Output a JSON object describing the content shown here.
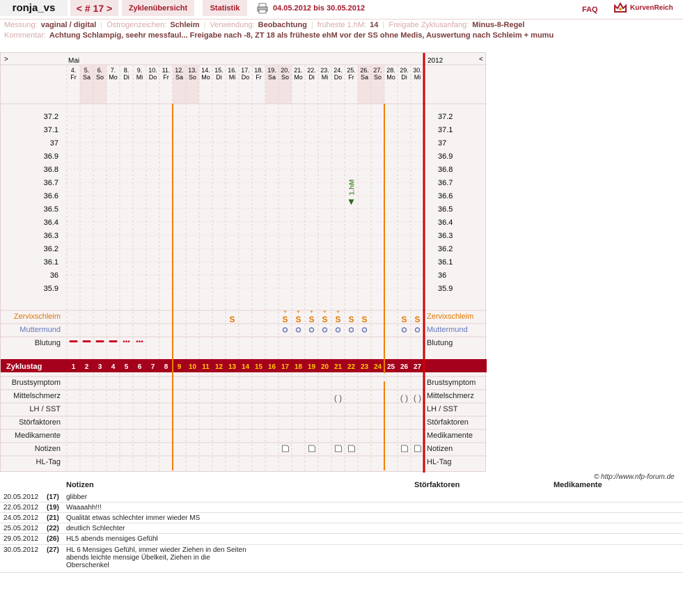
{
  "header": {
    "username": "ronja_vs",
    "cycle_prev": "<",
    "cycle_label": "# 17",
    "cycle_next": ">",
    "tab_overview": "Zyklenübersicht",
    "tab_stats": "Statistik",
    "print_icon": "printer-icon",
    "date_range": "04.05.2012 bis 30.05.2012",
    "faq": "FAQ",
    "logo_icon": "crown-icon",
    "logo_text": "KurvenReich"
  },
  "info": {
    "row1": [
      {
        "label": "Messung:",
        "value": "vaginal / digital"
      },
      {
        "label": "Östrogenzeichen:",
        "value": "Schleim"
      },
      {
        "label": "Verwendung:",
        "value": "Beobachtung"
      },
      {
        "label": "früheste 1.hM:",
        "value": "14"
      },
      {
        "label": "Freigabe Zyklusanfang:",
        "value": "Minus-8-Regel"
      }
    ],
    "comment_label": "Kommentar:",
    "comment": "Achtung Schlampig, seehr messfaul... Freigabe nach -8, ZT 18 als früheste ehM vor der SS ohne Medis, Auswertung nach Schleim + mumu"
  },
  "chart": {
    "nav_left": ">",
    "nav_right": "<",
    "month": "Mai",
    "year": "2012",
    "days": [
      {
        "d": "4.",
        "w": "Fr"
      },
      {
        "d": "5.",
        "w": "Sa"
      },
      {
        "d": "6.",
        "w": "So"
      },
      {
        "d": "7.",
        "w": "Mo"
      },
      {
        "d": "8.",
        "w": "Di"
      },
      {
        "d": "9.",
        "w": "Mi"
      },
      {
        "d": "10.",
        "w": "Do"
      },
      {
        "d": "11.",
        "w": "Fr"
      },
      {
        "d": "12.",
        "w": "Sa"
      },
      {
        "d": "13.",
        "w": "So"
      },
      {
        "d": "14.",
        "w": "Mo"
      },
      {
        "d": "15.",
        "w": "Di"
      },
      {
        "d": "16.",
        "w": "Mi"
      },
      {
        "d": "17.",
        "w": "Do"
      },
      {
        "d": "18.",
        "w": "Fr"
      },
      {
        "d": "19.",
        "w": "Sa"
      },
      {
        "d": "20.",
        "w": "So"
      },
      {
        "d": "21.",
        "w": "Mo"
      },
      {
        "d": "22.",
        "w": "Di"
      },
      {
        "d": "23.",
        "w": "Mi"
      },
      {
        "d": "24.",
        "w": "Do"
      },
      {
        "d": "25.",
        "w": "Fr"
      },
      {
        "d": "26.",
        "w": "Sa"
      },
      {
        "d": "27.",
        "w": "So"
      },
      {
        "d": "28.",
        "w": "Mo"
      },
      {
        "d": "29.",
        "w": "Di"
      },
      {
        "d": "30.",
        "w": "Mi"
      }
    ],
    "temps": [
      "37.2",
      "37.1",
      "37",
      "36.9",
      "36.8",
      "36.7",
      "36.6",
      "36.5",
      "36.4",
      "36.3",
      "36.2",
      "36.1",
      "36",
      "35.9"
    ],
    "marker_label": "1.hM",
    "marker_temp": 36.55,
    "marker_cycle_day": 22,
    "row_labels": {
      "cervix": "Zervixschleim",
      "mumu": "Muttermund",
      "bleeding": "Blutung",
      "cycle": "Zyklustag",
      "breast": "Brustsymptom",
      "midpain": "Mittelschmerz",
      "lh": "LH / SST",
      "disturb": "Störfaktoren",
      "meds": "Medikamente",
      "notes": "Notizen",
      "hl": "HL-Tag"
    },
    "cycle_days": [
      "1",
      "2",
      "3",
      "4",
      "5",
      "6",
      "7",
      "8",
      "9",
      "10",
      "11",
      "12",
      "13",
      "14",
      "15",
      "16",
      "17",
      "18",
      "19",
      "20",
      "21",
      "22",
      "23",
      "24",
      "25",
      "26",
      "27"
    ],
    "bleeding_days": [
      1,
      2,
      3,
      4,
      5,
      6
    ],
    "cervix_symbol": "S",
    "cervix_s_plus_days": [
      17,
      18,
      19,
      20,
      21
    ],
    "cervix_s_days": [
      13,
      22,
      23,
      26,
      27
    ],
    "mumu_days": [
      17,
      18,
      19,
      20,
      21,
      22,
      23,
      26,
      27
    ],
    "midpain_days": [
      21,
      26,
      27
    ],
    "notes_days": [
      17,
      19,
      21,
      22,
      26,
      27
    ]
  },
  "copyright": "© http://www.nfp-forum.de",
  "notes_table": {
    "headers": {
      "notes": "Notizen",
      "disturb": "Störfaktoren",
      "meds": "Medikamente"
    },
    "rows": [
      {
        "date": "20.05.2012",
        "cd": "(17)",
        "text": "glibber"
      },
      {
        "date": "22.05.2012",
        "cd": "(19)",
        "text": "Waaaahh!!!"
      },
      {
        "date": "24.05.2012",
        "cd": "(21)",
        "text": "Qualität etwas schlechter immer wieder MS"
      },
      {
        "date": "25.05.2012",
        "cd": "(22)",
        "text": "deutlich Schlechter"
      },
      {
        "date": "29.05.2012",
        "cd": "(26)",
        "text": "HL5 abends mensiges Gefühl"
      },
      {
        "date": "30.05.2012",
        "cd": "(27)",
        "text": "HL 6 Mensiges Gefühl, immer wieder Ziehen in den Seiten abends leichte mensige Übelkeit, Ziehen in die Oberschenkel"
      }
    ]
  }
}
